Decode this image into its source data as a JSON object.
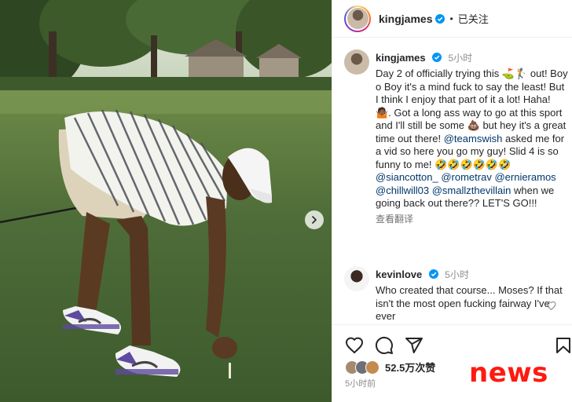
{
  "post_header": {
    "username": "kingjames",
    "separator": "•",
    "follow_state": "已关注"
  },
  "caption": {
    "username": "kingjames",
    "time": "5小时",
    "segments": [
      {
        "t": "Day 2 of officially trying this ⛳🏌 out! Boy o Boy it's a mind fuck to say the least! But I think I enjoy that part of it a lot! Haha! 🤷🏾. Got a long ass way to go at this sport and I'll still be some 💩 but hey it's a great time out there! "
      },
      {
        "m": "@teamswish"
      },
      {
        "t": " asked me for a vid so here you go my guy! Slid 4 is so funny to me! 🤣🤣🤣🤣🤣🤣 "
      },
      {
        "m": "@siancotton_"
      },
      {
        "t": " "
      },
      {
        "m": "@rometrav"
      },
      {
        "t": " "
      },
      {
        "m": "@ernieramos"
      },
      {
        "t": " "
      },
      {
        "m": "@chillwill03"
      },
      {
        "t": " "
      },
      {
        "m": "@smallzthevillain"
      },
      {
        "t": " when we going back out there?? LET'S GO!!!"
      }
    ],
    "see_translation": "查看翻译"
  },
  "comment": {
    "username": "kevinlove",
    "time": "5小时",
    "text": "Who created that course... Moses? If that isn't the most open fucking fairway I've ever"
  },
  "footer": {
    "likes": "52.5万次赞",
    "time": "5小时前"
  },
  "watermark": "news",
  "colors": {
    "accent_blue": "#0095f6",
    "mention": "#00376b",
    "watermark": "#ff1a10",
    "muted": "#8e8e8e"
  },
  "icons": [
    "verified-badge-icon",
    "chevron-right-icon",
    "heart-icon",
    "comment-icon",
    "share-icon",
    "bookmark-icon"
  ]
}
